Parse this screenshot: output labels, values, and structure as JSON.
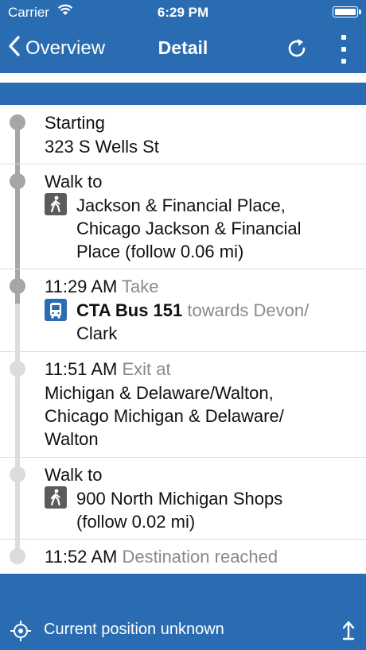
{
  "status": {
    "carrier": "Carrier",
    "time": "6:29 PM"
  },
  "nav": {
    "back_label": "Overview",
    "title": "Detail"
  },
  "steps": [
    {
      "label": "Starting",
      "lines": [
        "323 S Wells St"
      ]
    },
    {
      "label": "Walk to",
      "icon": "walk-icon",
      "lines": [
        "Jackson & Financial Place,",
        "Chicago Jackson & Financial",
        "Place (follow 0.06 mi)"
      ]
    },
    {
      "time": "11:29 AM",
      "label": "Take",
      "icon": "bus-icon",
      "route": "CTA Bus 151",
      "towards": "towards Devon/",
      "towards2": "Clark"
    },
    {
      "time": "11:51 AM",
      "label": "Exit at",
      "lines": [
        "Michigan & Delaware/Walton,",
        "Chicago Michigan & Delaware/",
        "Walton"
      ]
    },
    {
      "label": "Walk to",
      "icon": "walk-icon",
      "lines": [
        "900 North Michigan Shops",
        "(follow 0.02 mi)"
      ]
    },
    {
      "time": "11:52 AM",
      "label": "Destination reached"
    }
  ],
  "footer": {
    "position_text": "Current position unknown"
  },
  "colors": {
    "bar": "#2a6cb2",
    "timeline_done": "#a6a6a6",
    "timeline_pending": "#dcdcdc"
  }
}
